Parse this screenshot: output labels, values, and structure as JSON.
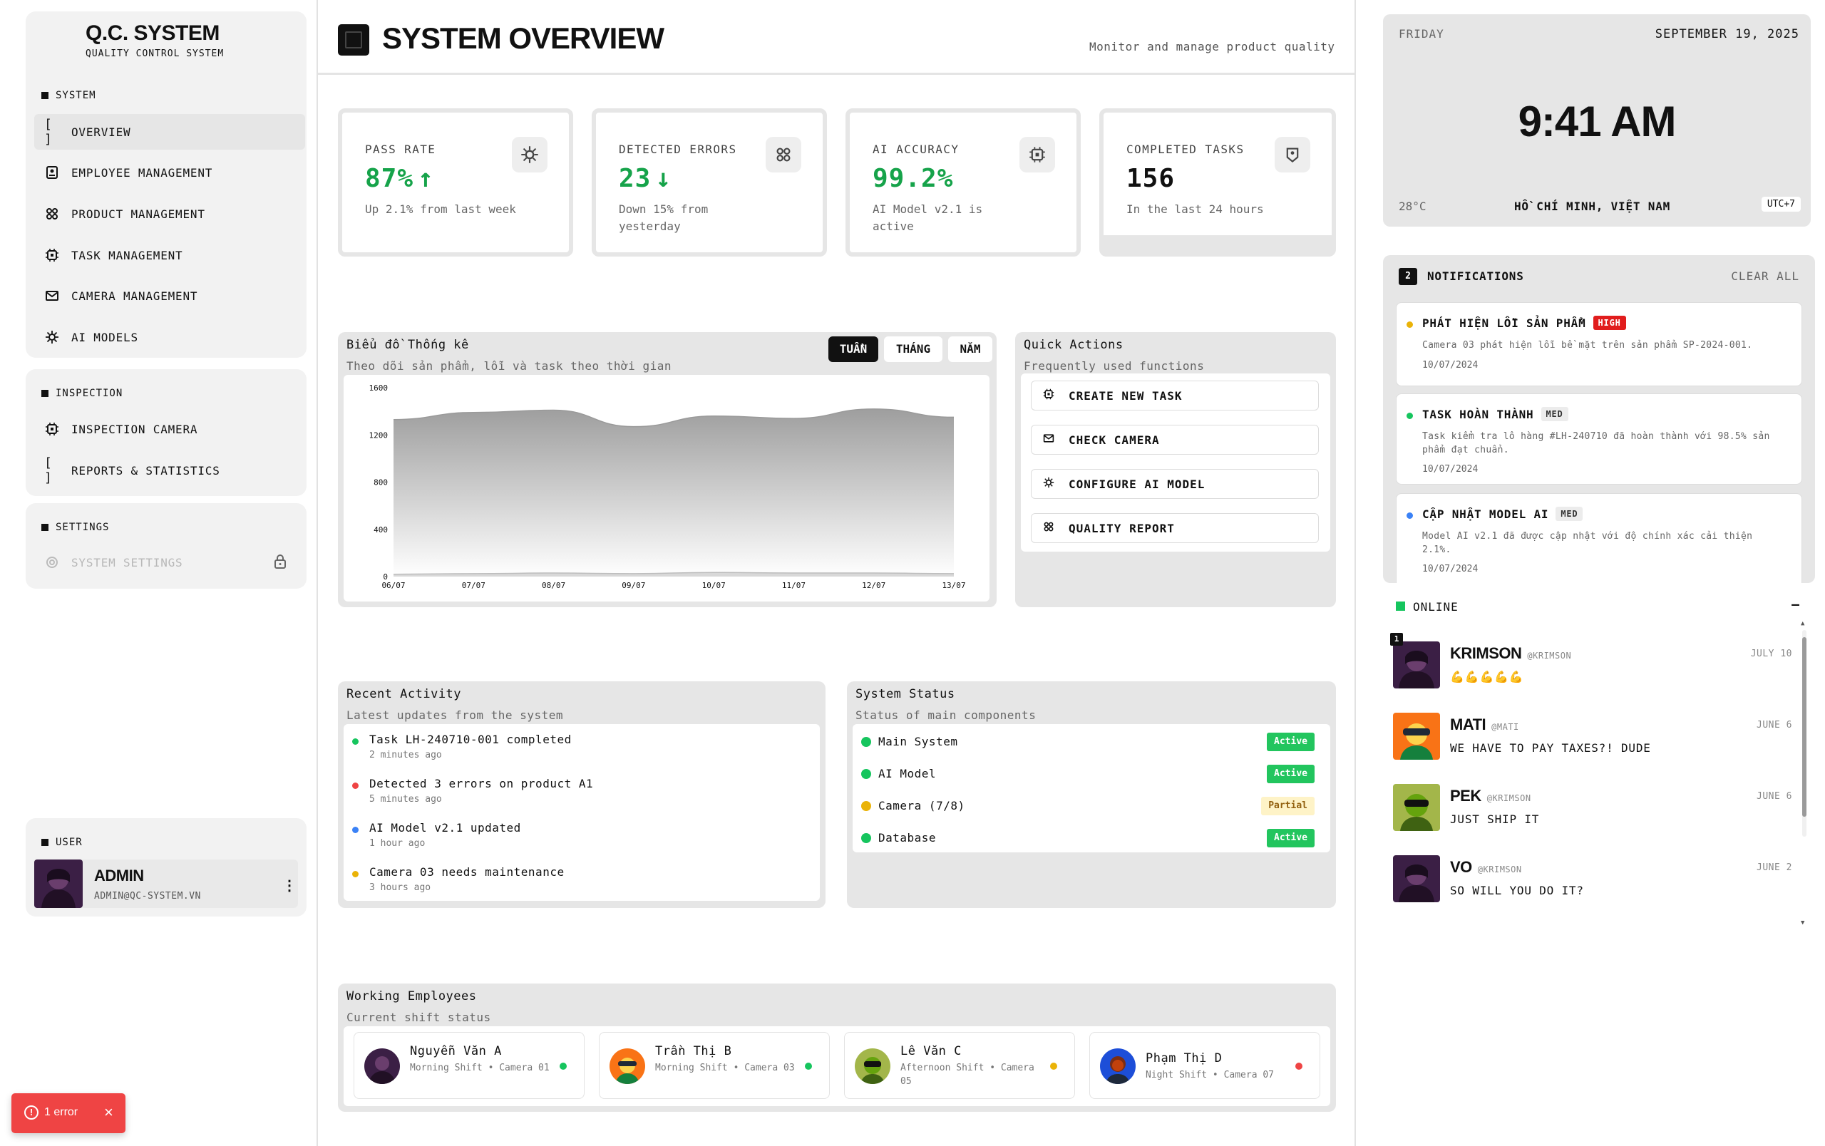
{
  "brand": {
    "title": "Q.C. SYSTEM",
    "subtitle": "QUALITY CONTROL SYSTEM"
  },
  "sidebar": {
    "system_section": "SYSTEM",
    "system_items": [
      {
        "label": "OVERVIEW",
        "icon": "brackets-icon"
      },
      {
        "label": "EMPLOYEE MANAGEMENT",
        "icon": "badge-icon"
      },
      {
        "label": "PRODUCT MANAGEMENT",
        "icon": "bug-icon"
      },
      {
        "label": "TASK MANAGEMENT",
        "icon": "chip-icon"
      },
      {
        "label": "CAMERA MANAGEMENT",
        "icon": "envelope-icon"
      },
      {
        "label": "AI MODELS",
        "icon": "gear-burst-icon"
      }
    ],
    "inspection_section": "INSPECTION",
    "inspection_items": [
      {
        "label": "INSPECTION CAMERA",
        "icon": "chip-icon"
      },
      {
        "label": "REPORTS & STATISTICS",
        "icon": "brackets-icon"
      }
    ],
    "settings_section": "SETTINGS",
    "settings_items": [
      {
        "label": "SYSTEM SETTINGS",
        "icon": "gear-icon"
      }
    ],
    "user_section": "USER",
    "user": {
      "name": "ADMIN",
      "email": "ADMIN@QC-SYSTEM.VN"
    }
  },
  "header": {
    "title": "SYSTEM OVERVIEW",
    "subtitle": "Monitor and manage product quality"
  },
  "stats": [
    {
      "label": "PASS RATE",
      "value": "87%",
      "arrow": "↑",
      "desc": "Up 2.1% from last week",
      "color": "#16a34a"
    },
    {
      "label": "DETECTED ERRORS",
      "value": "23",
      "arrow": "↓",
      "desc": "Down 15% from yesterday",
      "color": "#16a34a"
    },
    {
      "label": "AI ACCURACY",
      "value": "99.2%",
      "arrow": "",
      "desc": "AI Model v2.1 is active",
      "color": "#16a34a"
    },
    {
      "label": "COMPLETED TASKS",
      "value": "156",
      "arrow": "",
      "desc": "In the last 24 hours",
      "color": "#111111"
    }
  ],
  "chart_panel": {
    "title": "Biểu đồ Thống kê",
    "subtitle": "Theo dõi sản phẩm, lỗi và task theo thời gian",
    "tabs": [
      "TUẦN",
      "THÁNG",
      "NĂM"
    ],
    "active_tab": "TUẦN"
  },
  "chart_data": {
    "type": "area",
    "x": [
      "06/07",
      "07/07",
      "08/07",
      "09/07",
      "10/07",
      "11/07",
      "12/07",
      "13/07"
    ],
    "series": [
      {
        "values": [
          1330,
          1390,
          1410,
          1270,
          1360,
          1340,
          1420,
          1350
        ]
      },
      {
        "values": [
          20,
          25,
          30,
          25,
          35,
          30,
          30,
          25
        ]
      }
    ],
    "yticks": [
      0,
      400,
      800,
      1200,
      1600
    ],
    "ylim": [
      0,
      1600
    ],
    "grid": false
  },
  "quick_actions": {
    "title": "Quick Actions",
    "subtitle": "Frequently used functions",
    "items": [
      {
        "label": "CREATE NEW TASK",
        "icon": "chip-icon"
      },
      {
        "label": "CHECK CAMERA",
        "icon": "envelope-icon"
      },
      {
        "label": "CONFIGURE AI MODEL",
        "icon": "gear-burst-icon"
      },
      {
        "label": "QUALITY REPORT",
        "icon": "bug-icon"
      }
    ]
  },
  "recent_activity": {
    "title": "Recent Activity",
    "subtitle": "Latest updates from the system",
    "items": [
      {
        "text": "Task LH-240710-001 completed",
        "time": "2 minutes ago",
        "color": "#16c55e"
      },
      {
        "text": "Detected 3 errors on product A1",
        "time": "5 minutes ago",
        "color": "#ef4444"
      },
      {
        "text": "AI Model v2.1 updated",
        "time": "1 hour ago",
        "color": "#3b82f6"
      },
      {
        "text": "Camera 03 needs maintenance",
        "time": "3 hours ago",
        "color": "#eab308"
      }
    ]
  },
  "system_status": {
    "title": "System Status",
    "subtitle": "Status of main components",
    "items": [
      {
        "name": "Main System",
        "status": "Active",
        "kind": "active"
      },
      {
        "name": "AI Model",
        "status": "Active",
        "kind": "active"
      },
      {
        "name": "Camera (7/8)",
        "status": "Partial",
        "kind": "partial"
      },
      {
        "name": "Database",
        "status": "Active",
        "kind": "active"
      }
    ]
  },
  "employees": {
    "title": "Working Employees",
    "subtitle": "Current shift status",
    "items": [
      {
        "name": "Nguyễn Văn A",
        "meta": "Morning Shift • Camera 01",
        "status_color": "#16c55e"
      },
      {
        "name": "Trần Thị B",
        "meta": "Morning Shift • Camera 03",
        "status_color": "#16c55e"
      },
      {
        "name": "Lê Văn C",
        "meta": "Afternoon Shift • Camera 05",
        "status_color": "#eab308"
      },
      {
        "name": "Phạm Thị D",
        "meta": "Night Shift • Camera 07",
        "status_color": "#ef4444"
      }
    ]
  },
  "clock": {
    "day": "FRIDAY",
    "date": "SEPTEMBER 19, 2025",
    "time": "9:41 AM",
    "temp": "28°C",
    "location": "HỒ CHÍ MINH, VIỆT NAM",
    "tz": "UTC+7"
  },
  "notifications": {
    "count": "2",
    "title": "NOTIFICATIONS",
    "clear": "CLEAR ALL",
    "items": [
      {
        "title": "PHÁT HIỆN LỖI SẢN PHẨM",
        "priority": "HIGH",
        "body": "Camera 03 phát hiện lỗi bề mặt trên sản phẩm SP-2024-001.",
        "date": "10/07/2024",
        "dot": "#eab308"
      },
      {
        "title": "TASK HOÀN THÀNH",
        "priority": "MED",
        "body": "Task kiểm tra lô hàng #LH-240710 đã hoàn thành với 98.5% sản phẩm đạt chuẩn.",
        "date": "10/07/2024",
        "dot": "#16c55e"
      },
      {
        "title": "CẬP NHẬT MODEL AI",
        "priority": "MED",
        "body": "Model AI v2.1 đã được cập nhật với độ chính xác cải thiện 2.1%.",
        "date": "10/07/2024",
        "dot": "#3b82f6"
      }
    ]
  },
  "online": {
    "title": "ONLINE",
    "collapse": "—",
    "items": [
      {
        "name": "KRIMSON",
        "handle": "@KRIMSON",
        "date": "JULY 10",
        "message": "💪💪💪💪💪",
        "badge": "1"
      },
      {
        "name": "MATI",
        "handle": "@MATI",
        "date": "JUNE 6",
        "message": "WE HAVE TO PAY TAXES?! DUDE",
        "badge": ""
      },
      {
        "name": "PEK",
        "handle": "@KRIMSON",
        "date": "JUNE 6",
        "message": "JUST SHIP IT",
        "badge": ""
      },
      {
        "name": "VO",
        "handle": "@KRIMSON",
        "date": "JUNE 2",
        "message": "SO WILL YOU DO IT?",
        "badge": ""
      }
    ]
  },
  "error_toast": {
    "label": "1 error"
  },
  "colors": {
    "green": "#16a34a",
    "active_badge": "#22c55e",
    "partial_badge": "#fef3c7",
    "high_badge": "#e11d1d",
    "toast": "#ef4444"
  }
}
